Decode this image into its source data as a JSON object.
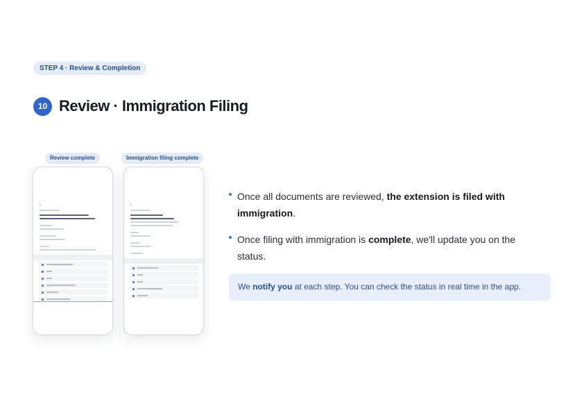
{
  "step_label": "STEP 4 · Review & Completion",
  "section_number": "10",
  "page_title": "Review · Immigration Filing",
  "phones": [
    {
      "label": "Review complete"
    },
    {
      "label": "Immigration filing complete"
    }
  ],
  "bullets": [
    {
      "pre": "Once all documents are reviewed, ",
      "bold": "the extension is filed with immigration",
      "post": "."
    },
    {
      "pre": "Once filing with immigration is ",
      "bold": "complete",
      "post": ", we'll update you on the status."
    }
  ],
  "notice": {
    "pre": "We ",
    "bold": "notify you",
    "post": " at each step. You can check the status in real time in the app."
  },
  "colors": {
    "accent": "#2f66c9",
    "pill_bg": "#e4ecf8",
    "notice_bg": "#e8eefa",
    "pill_text": "#2b4d8f"
  }
}
